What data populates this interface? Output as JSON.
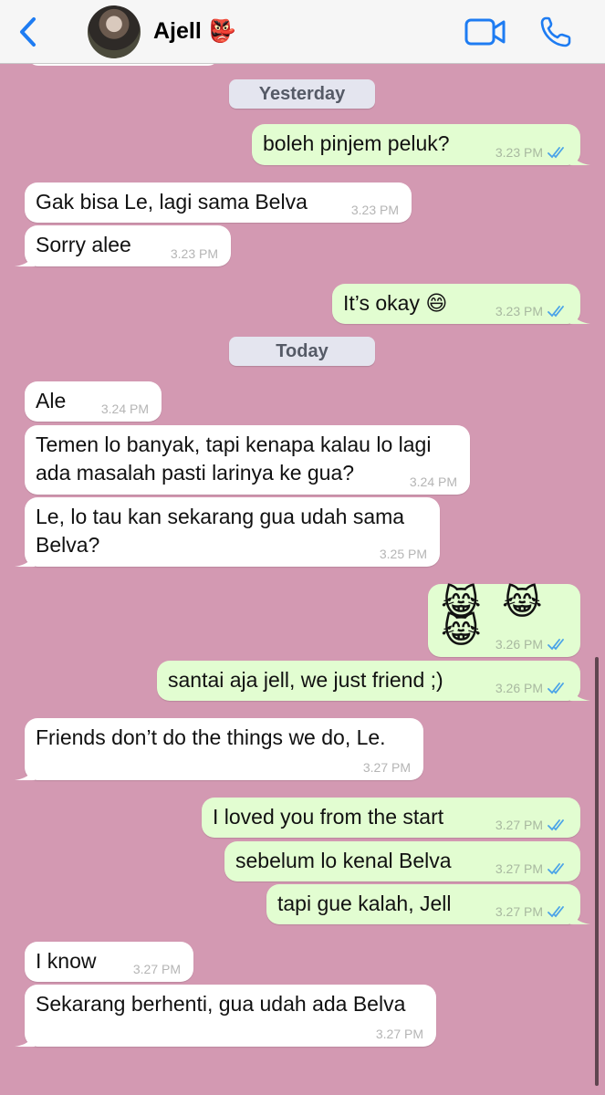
{
  "header": {
    "contact_name": "Ajell",
    "contact_emoji": "👺",
    "icons": {
      "back": "chevron-left-icon",
      "video": "video-camera-icon",
      "call": "phone-icon"
    },
    "accent_color": "#1e7cf2"
  },
  "chat": {
    "background_color": "#d399b2",
    "date_yesterday": "Yesterday",
    "date_today": "Today",
    "messages": [
      {
        "direction": "out",
        "text": "boleh pinjem peluk?",
        "time": "3.23 PM",
        "read": true
      },
      {
        "direction": "in",
        "text": "Gak bisa Le, lagi sama Belva",
        "time": "3.23 PM"
      },
      {
        "direction": "in",
        "text": "Sorry alee",
        "time": "3.23 PM"
      },
      {
        "direction": "out",
        "text": "It’s okay 😄",
        "time": "3.23 PM",
        "read": true
      },
      {
        "direction": "in",
        "text": "Ale",
        "time": "3.24 PM"
      },
      {
        "direction": "in",
        "text": "Temen lo banyak, tapi kenapa kalau lo lagi\nada masalah pasti larinya ke gua?",
        "time": "3.24 PM"
      },
      {
        "direction": "in",
        "text": "Le, lo tau kan sekarang gua udah sama\nBelva?",
        "time": "3.25 PM"
      },
      {
        "direction": "out",
        "text": "😹 😹 😹",
        "time": "3.26 PM",
        "read": true
      },
      {
        "direction": "out",
        "text": "santai aja jell, we just friend ;)",
        "time": "3.26 PM",
        "read": true
      },
      {
        "direction": "in",
        "text": "Friends don’t do the things we do, Le.",
        "time": "3.27 PM"
      },
      {
        "direction": "out",
        "text": "I loved you from the start",
        "time": "3.27 PM",
        "read": true
      },
      {
        "direction": "out",
        "text": "sebelum lo kenal Belva",
        "time": "3.27 PM",
        "read": true
      },
      {
        "direction": "out",
        "text": "tapi gue kalah, Jell",
        "time": "3.27 PM",
        "read": true
      },
      {
        "direction": "in",
        "text": "I know",
        "time": "3.27 PM"
      },
      {
        "direction": "in",
        "text": "Sekarang berhenti, gua udah ada Belva",
        "time": "3.27 PM"
      }
    ]
  }
}
